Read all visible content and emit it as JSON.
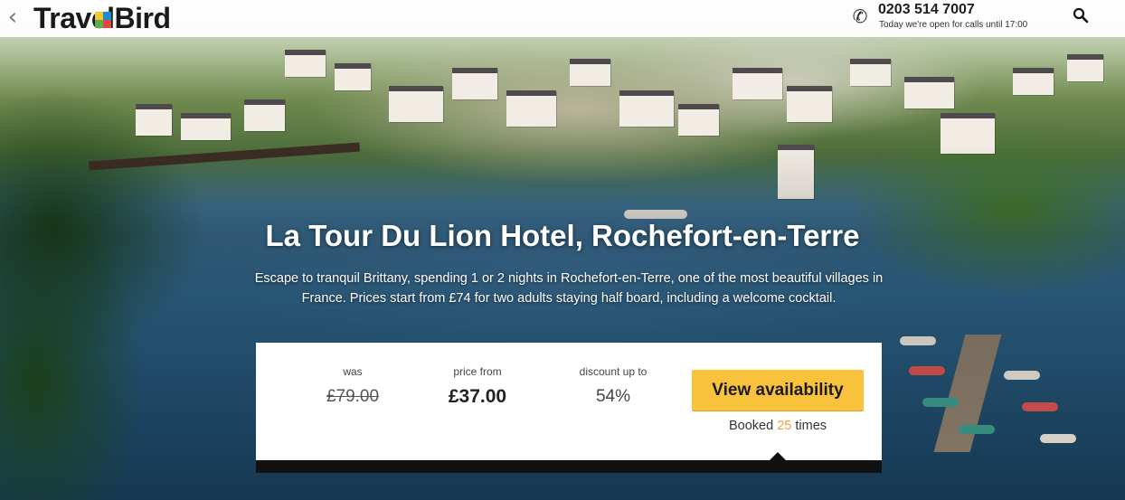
{
  "header": {
    "back_icon": "chevron-left-icon",
    "logo_text": "TravelBird",
    "logo_colors": [
      "#f7c52e",
      "#1a8fd8",
      "#e8443a",
      "#5ab04a"
    ],
    "phone_icon": "phone-icon",
    "phone_number": "0203 514 7007",
    "phone_hours": "Today we're open for calls until 17:00",
    "search_icon": "search-icon"
  },
  "hero": {
    "title": "La Tour Du Lion Hotel, Rochefort-en-Terre",
    "description": "Escape to tranquil Brittany, spending 1 or 2 nights in Rochefort-en-Terre, one of the most beautiful villages in France. Prices start from £74 for two adults staying half board, including a welcome cocktail."
  },
  "pricing": {
    "was_label": "was",
    "was_value": "£79.00",
    "from_label": "price from",
    "from_value": "£37.00",
    "discount_label": "discount up to",
    "discount_value": "54%",
    "cta_label": "View availability",
    "booked_prefix": "Booked",
    "booked_count": "25",
    "booked_suffix": "times",
    "accent_color": "#f9c23c"
  }
}
